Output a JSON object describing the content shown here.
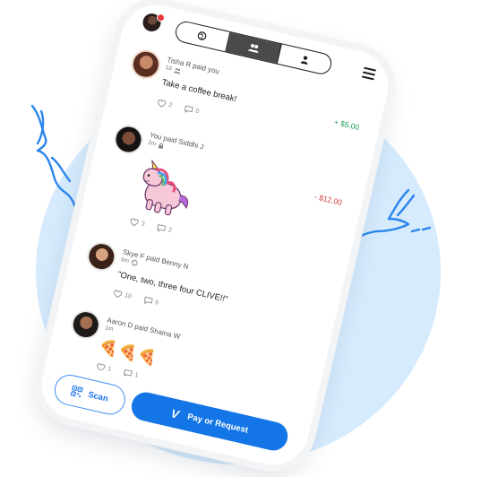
{
  "colors": {
    "brand_blue": "#1475e6",
    "positive": "#1f9d55",
    "negative": "#d23a3a",
    "background_blob": "#d6ebfd"
  },
  "topbar": {
    "tabs": [
      {
        "icon": "globe-icon"
      },
      {
        "icon": "friends-icon",
        "active": true
      },
      {
        "icon": "person-icon"
      }
    ]
  },
  "feed": [
    {
      "title": "Tisha R paid you",
      "meta": "1d",
      "message": "Take a coffee break!",
      "amount": "+ $5.00",
      "likes": "2",
      "comments": "0"
    },
    {
      "title": "You paid Siddhi J",
      "meta": "2m",
      "sticker": "unicorn",
      "amount": "- $12.00",
      "likes": "3",
      "comments": "2"
    },
    {
      "title": "Skye F paid Benny N",
      "meta": "6m",
      "message": "\"One, two, three four CLIVE!!\"",
      "likes": "10",
      "comments": "6"
    },
    {
      "title": "Aaron D paid Shaina W",
      "meta": "1m",
      "emoji": "🍕🍕🍕",
      "likes": "1",
      "comments": "1"
    }
  ],
  "bottom": {
    "scan_label": "Scan",
    "pay_label": "Pay or Request",
    "logo_glyph": "V"
  }
}
